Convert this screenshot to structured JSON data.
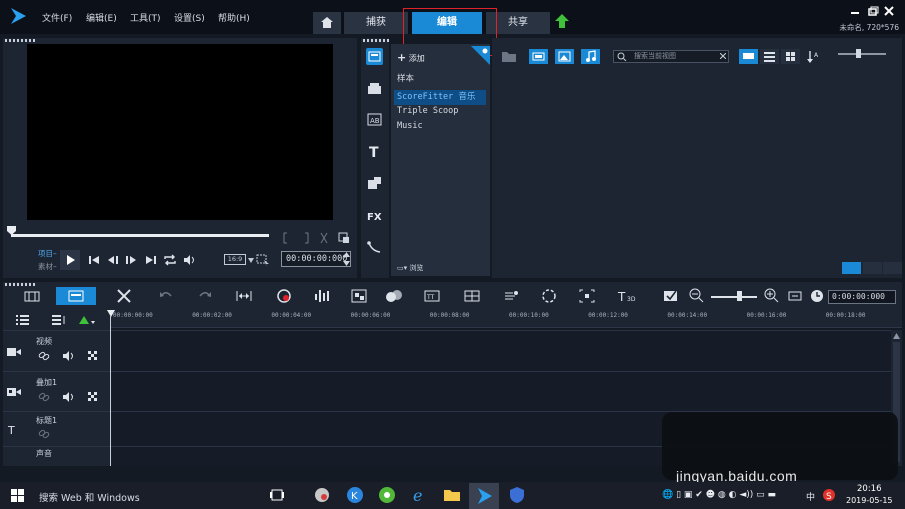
{
  "menu": {
    "file": "文件(F)",
    "edit": "编辑(E)",
    "tools": "工具(T)",
    "settings": "设置(S)",
    "help": "帮助(H)"
  },
  "tabs": {
    "capture": "捕获",
    "edit": "编辑",
    "share": "共享"
  },
  "project_info": "未命名, 720*576",
  "player": {
    "mode_project": "项目",
    "mode_clip": "素材",
    "aspect": "16:9",
    "timecode": "00:00:00:000"
  },
  "library": {
    "add_label": "添加",
    "items": [
      "样本",
      "ScoreFitter 音乐",
      "Triple Scoop Music"
    ],
    "browse_label": "浏览",
    "search_placeholder": "搜索当前视图"
  },
  "timeline": {
    "timecode": "0:00:00:000",
    "ticks": [
      "00:00:00:00",
      "00:00:02:00",
      "00:00:04:00",
      "00:00:06:00",
      "00:00:08:00",
      "00:00:10:00",
      "00:00:12:00",
      "00:00:14:00",
      "00:00:16:00",
      "00:00:18:00"
    ],
    "tracks": [
      "视频",
      "叠加1",
      "标题1",
      "声音"
    ]
  },
  "watermark": "jingyan.baidu.com",
  "taskbar": {
    "search": "搜索 Web 和 Windows",
    "ime": "中",
    "time": "20:16",
    "date": "2019-05-15"
  },
  "colors": {
    "accent": "#1b8ad6",
    "highlight": "#e0222a",
    "upload_green": "#3fc23a"
  }
}
